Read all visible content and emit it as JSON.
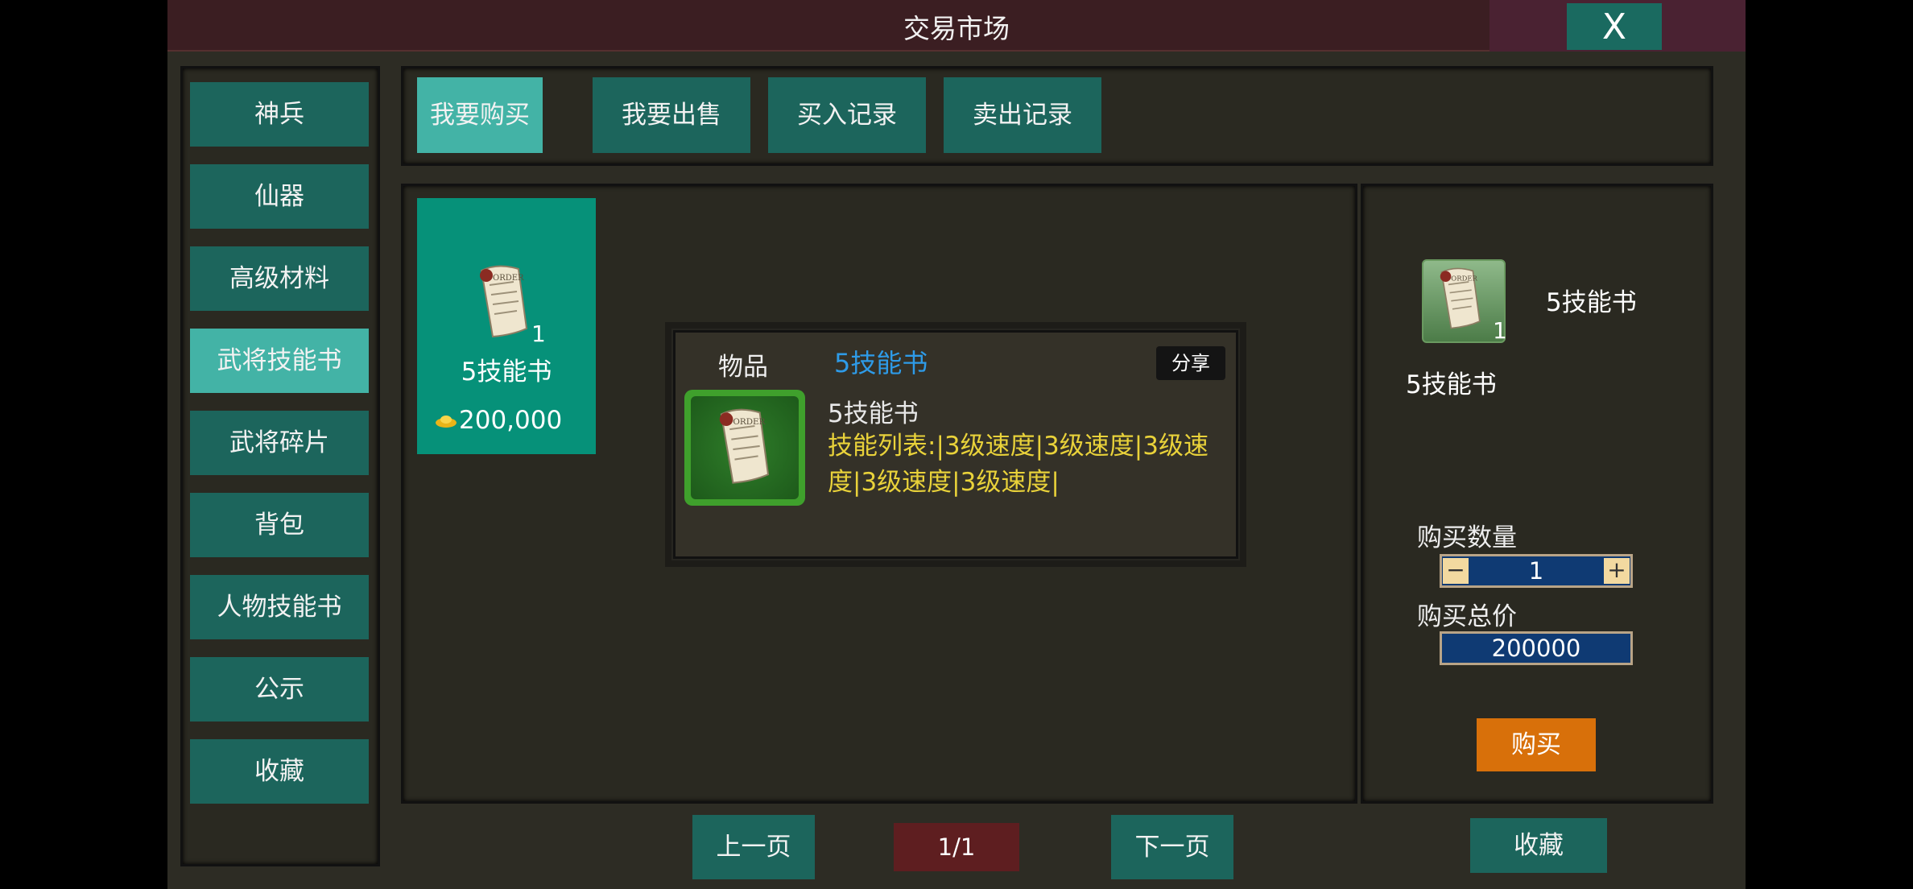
{
  "window": {
    "title": "交易市场",
    "close_label": "X"
  },
  "sidebar": {
    "items": [
      {
        "label": "神兵"
      },
      {
        "label": "仙器"
      },
      {
        "label": "高级材料"
      },
      {
        "label": "武将技能书"
      },
      {
        "label": "武将碎片"
      },
      {
        "label": "背包"
      },
      {
        "label": "人物技能书"
      },
      {
        "label": "公示"
      },
      {
        "label": "收藏"
      }
    ],
    "active_index": 3
  },
  "tabs": [
    {
      "label": "我要购买"
    },
    {
      "label": "我要出售"
    },
    {
      "label": "买入记录"
    },
    {
      "label": "卖出记录"
    }
  ],
  "item_card": {
    "name": "5技能书",
    "count": "1",
    "price": "200,000"
  },
  "tooltip": {
    "label": "物品",
    "title": "5技能书",
    "share_label": "分享",
    "name": "5技能书",
    "description": "技能列表:|3级速度|3级速度|3级速度|3级速度|3级速度|"
  },
  "detail": {
    "count": "1",
    "name_right": "5技能书",
    "name_left": "5技能书",
    "qty_label": "购买数量",
    "qty_value": "1",
    "minus": "−",
    "plus": "+",
    "total_label": "购买总价",
    "total_value": "200000",
    "buy_label": "购买"
  },
  "pagination": {
    "prev_label": "上一页",
    "page": "1/1",
    "next_label": "下一页"
  },
  "favorite_label": "收藏",
  "colors": {
    "teal": "#1c655c",
    "teal_active": "#43b3a6",
    "card": "#069179",
    "buy": "#d8700a",
    "desc": "#e9d23a",
    "title_link": "#2e9be8"
  },
  "icons": {
    "item": "scroll-order-icon",
    "currency": "gold-ingot-icon"
  }
}
